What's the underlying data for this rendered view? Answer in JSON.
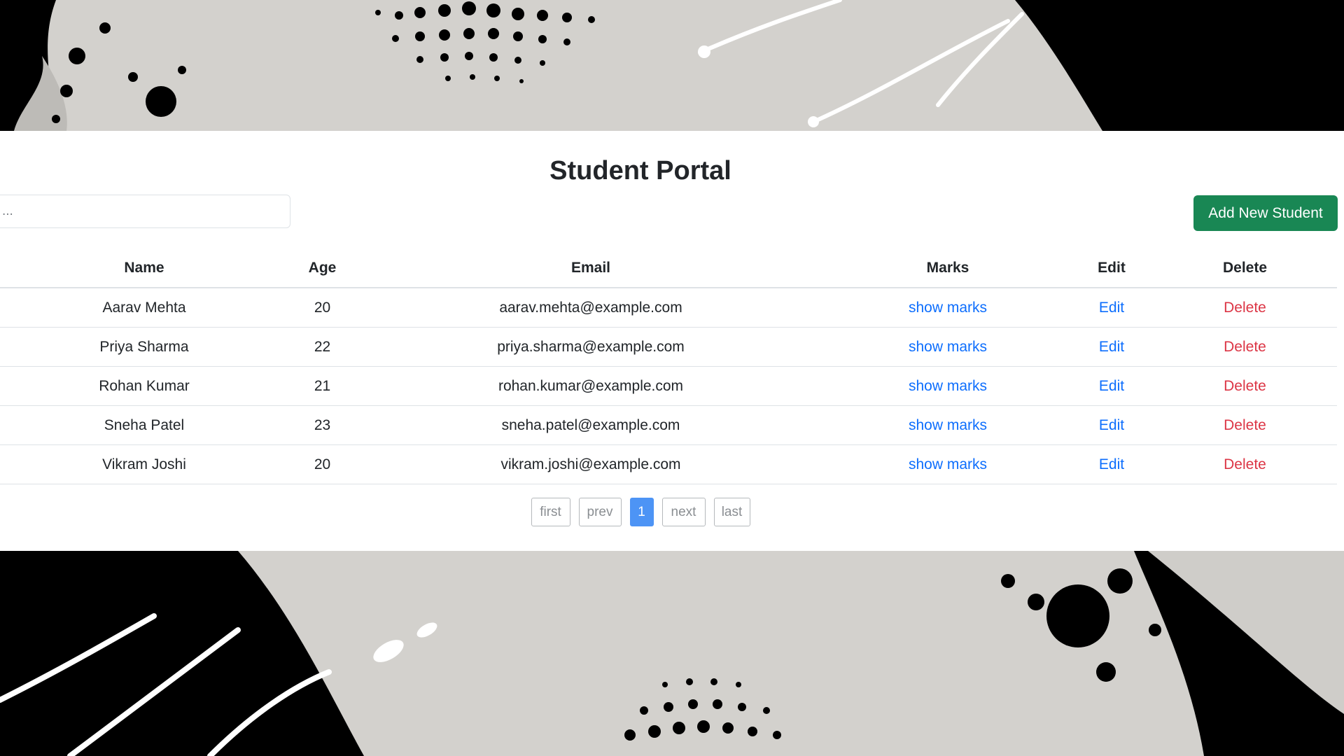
{
  "page": {
    "title": "Student Portal",
    "search_placeholder": "...",
    "add_button_label": "Add New Student"
  },
  "table": {
    "headers": [
      "Name",
      "Age",
      "Email",
      "Marks",
      "Edit",
      "Delete"
    ],
    "rows": [
      {
        "name": "Aarav Mehta",
        "age": "20",
        "email": "aarav.mehta@example.com",
        "marks": "show marks",
        "edit": "Edit",
        "delete": "Delete"
      },
      {
        "name": "Priya Sharma",
        "age": "22",
        "email": "priya.sharma@example.com",
        "marks": "show marks",
        "edit": "Edit",
        "delete": "Delete"
      },
      {
        "name": "Rohan Kumar",
        "age": "21",
        "email": "rohan.kumar@example.com",
        "marks": "show marks",
        "edit": "Edit",
        "delete": "Delete"
      },
      {
        "name": "Sneha Patel",
        "age": "23",
        "email": "sneha.patel@example.com",
        "marks": "show marks",
        "edit": "Edit",
        "delete": "Delete"
      },
      {
        "name": "Vikram Joshi",
        "age": "20",
        "email": "vikram.joshi@example.com",
        "marks": "show marks",
        "edit": "Edit",
        "delete": "Delete"
      }
    ]
  },
  "pagination": {
    "first": "first",
    "prev": "prev",
    "current": "1",
    "next": "next",
    "last": "last"
  },
  "colors": {
    "primary_button": "#198754",
    "link": "#0d6efd",
    "delete_link": "#dc3545",
    "active_page": "#4d94f5"
  }
}
